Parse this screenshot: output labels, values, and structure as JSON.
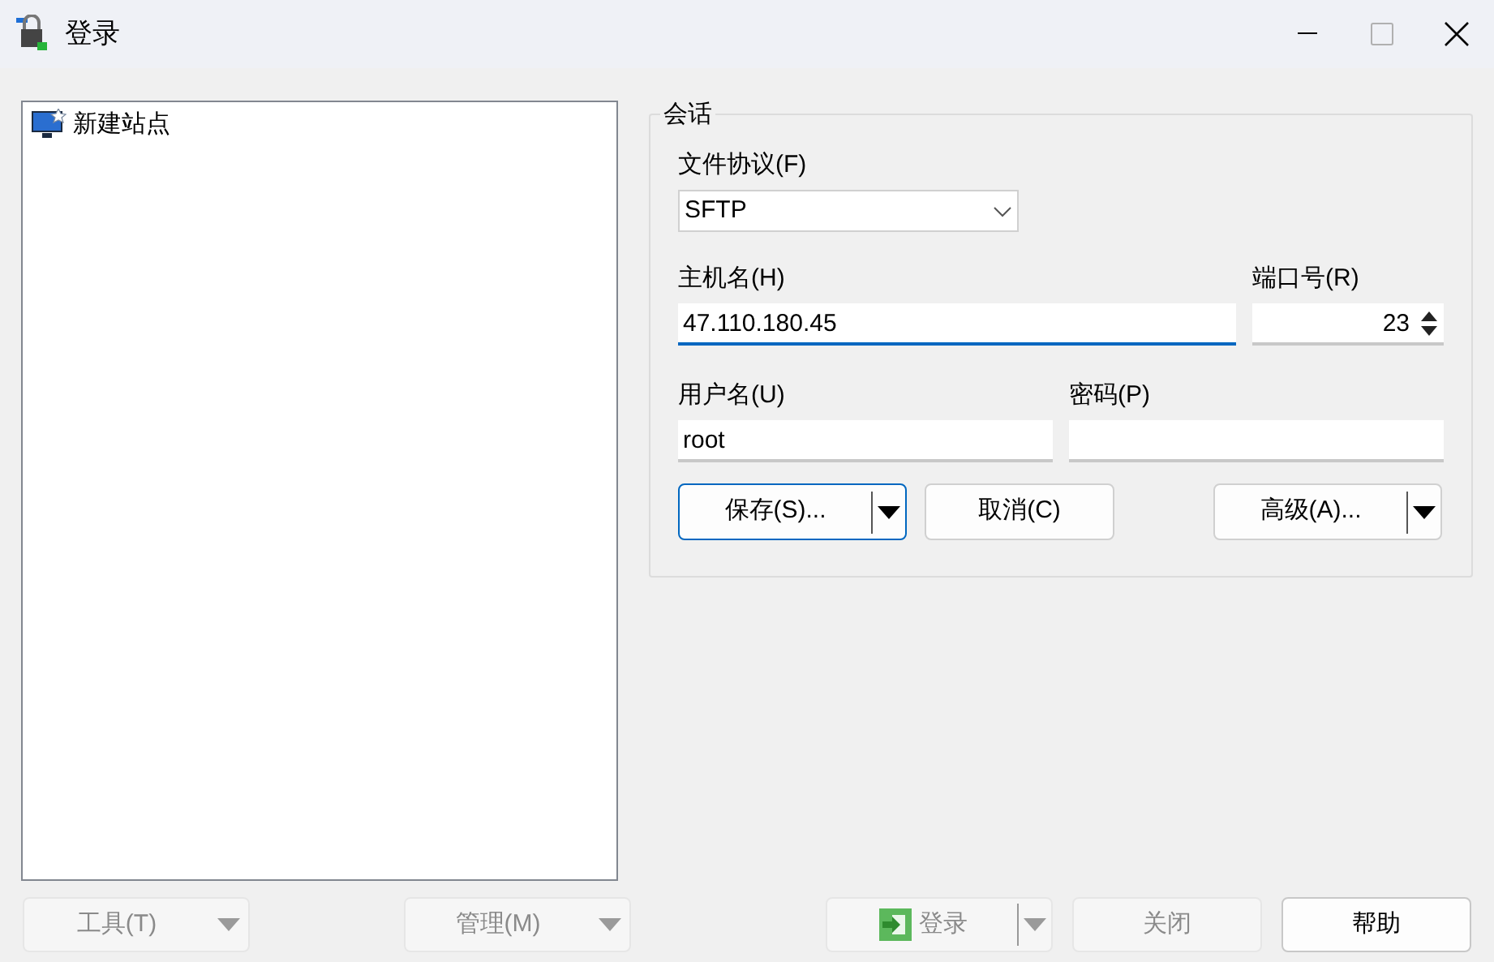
{
  "window": {
    "title": "登录",
    "maximize_disabled": true
  },
  "sites": [
    {
      "label": "新建站点",
      "selected": false
    }
  ],
  "session": {
    "title": "会话",
    "protocol": {
      "label": "文件协议(F)",
      "value": "SFTP"
    },
    "host": {
      "label": "主机名(H)",
      "value": "47.110.180.45",
      "focused": true
    },
    "port": {
      "label": "端口号(R)",
      "value": "23"
    },
    "user": {
      "label": "用户名(U)",
      "value": "root"
    },
    "password": {
      "label": "密码(P)"
    },
    "buttons": [
      {
        "label": "保存(S)...",
        "kind": "split",
        "default": true
      },
      {
        "label": "取消(C)",
        "kind": "plain",
        "default": false
      },
      {
        "label": "高级(A)...",
        "kind": "split",
        "default": false
      }
    ]
  },
  "footer_left": [
    {
      "label": "工具(T)",
      "disabled": true
    },
    {
      "label": "管理(M)",
      "disabled": true
    }
  ],
  "footer_right": [
    {
      "label": "登录",
      "kind": "split",
      "disabled": true
    },
    {
      "label": "关闭",
      "kind": "plain",
      "disabled": true
    },
    {
      "label": "帮助",
      "kind": "plain",
      "disabled": false
    }
  ]
}
